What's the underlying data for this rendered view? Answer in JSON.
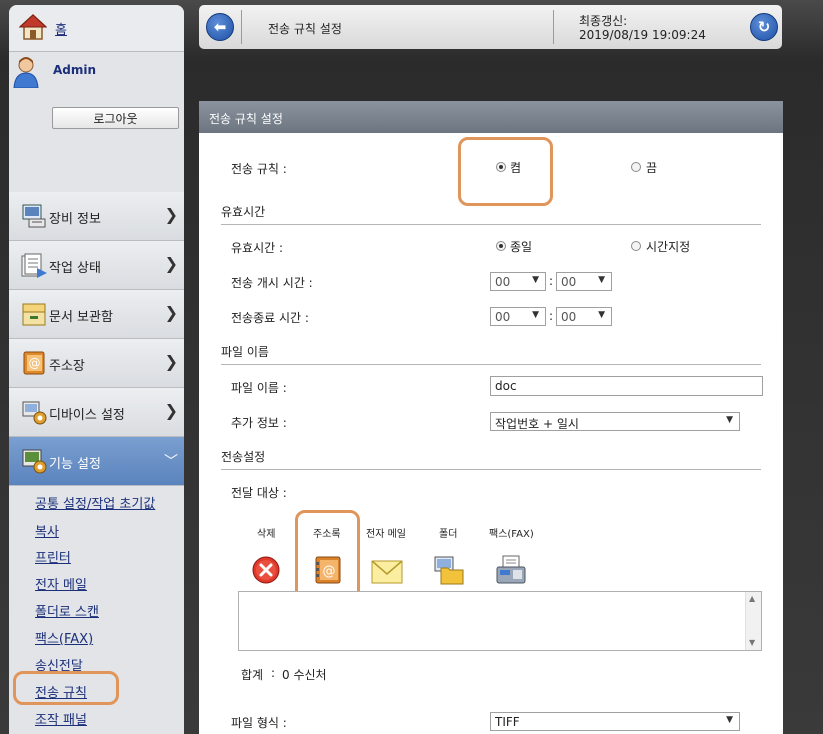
{
  "sidebar": {
    "home_label": "홈",
    "user_name": "Admin",
    "logout_label": "로그아웃",
    "nav": [
      {
        "label": "장비 정보",
        "icon": "device-info-icon"
      },
      {
        "label": "작업 상태",
        "icon": "job-status-icon"
      },
      {
        "label": "문서 보관함",
        "icon": "document-box-icon"
      },
      {
        "label": "주소장",
        "icon": "address-book-icon"
      },
      {
        "label": "디바이스 설정",
        "icon": "device-settings-icon"
      },
      {
        "label": "기능 설정",
        "icon": "function-settings-icon"
      }
    ],
    "sub_items": [
      "공통 설정/작업 초기값",
      "복사",
      "프린터",
      "전자 메일",
      "폴더로 스캔",
      "팩스(FAX)",
      "송신전달",
      "전송 규칙",
      "조작 패널"
    ],
    "active_sub": "전송 규칙"
  },
  "topbar": {
    "title": "전송 규칙 설정",
    "updated_label": "최종갱신:",
    "updated_value": "2019/08/19 19:09:24"
  },
  "panel": {
    "header": "전송 규칙 설정",
    "rule_label": "전송 규칙 :",
    "rule_on": "켬",
    "rule_off": "끔",
    "rule_selected": "켬",
    "validity_section": "유효시간",
    "validity_label": "유효시간 :",
    "validity_allday": "종일",
    "validity_custom": "시간지정",
    "start_label": "전송 개시 시간 :",
    "end_label": "전송종료 시간 :",
    "start_hour": "00",
    "start_min": "00",
    "end_hour": "00",
    "end_min": "00",
    "time_colon": ":",
    "filename_section": "파일 이름",
    "filename_label": "파일 이름 :",
    "filename_value": "doc",
    "extra_label": "추가 정보 :",
    "extra_value": "작업번호 + 일시",
    "transfer_section": "전송설정",
    "dest_label": "전달 대상 :",
    "dest_buttons": [
      "삭제",
      "주소록",
      "전자 메일",
      "폴더",
      "팩스(FAX)"
    ],
    "total_label": "합계",
    "total_colon": ":",
    "total_value": "0 수신처",
    "format_label": "파일 형식 :",
    "format_value": "TIFF"
  },
  "colors": {
    "highlight": "#e0955a",
    "accent_blue": "#1d4fa6",
    "link": "#1b2f7a"
  }
}
